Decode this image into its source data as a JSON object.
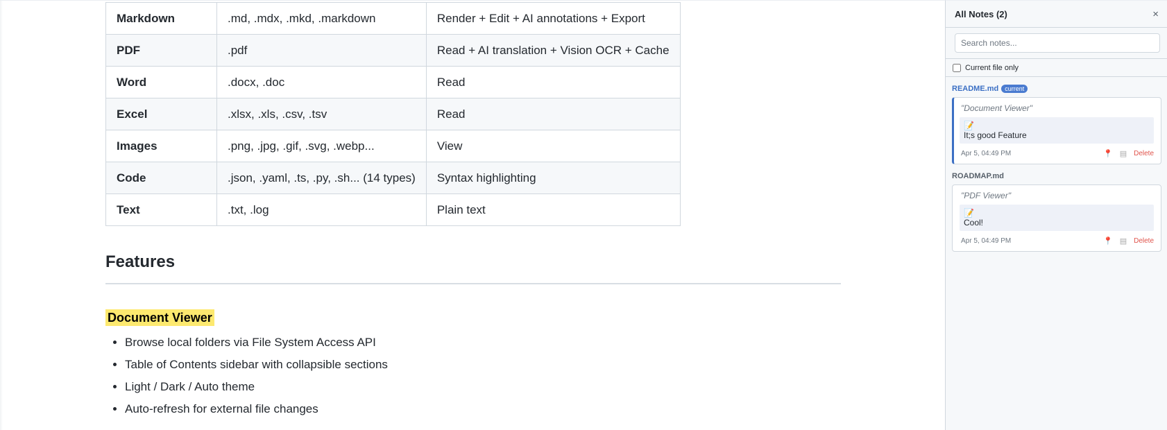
{
  "table": {
    "rows": [
      {
        "type": "Markdown",
        "ext": ".md, .mdx, .mkd, .markdown",
        "feature": "Render + Edit + AI annotations + Export"
      },
      {
        "type": "PDF",
        "ext": ".pdf",
        "feature": "Read + AI translation + Vision OCR + Cache"
      },
      {
        "type": "Word",
        "ext": ".docx, .doc",
        "feature": "Read"
      },
      {
        "type": "Excel",
        "ext": ".xlsx, .xls, .csv, .tsv",
        "feature": "Read"
      },
      {
        "type": "Images",
        "ext": ".png, .jpg, .gif, .svg, .webp...",
        "feature": "View"
      },
      {
        "type": "Code",
        "ext": ".json, .yaml, .ts, .py, .sh... (14 types)",
        "feature": "Syntax highlighting"
      },
      {
        "type": "Text",
        "ext": ".txt, .log",
        "feature": "Plain text"
      }
    ]
  },
  "features": {
    "heading": "Features",
    "subheading": "Document Viewer",
    "items": [
      "Browse local folders via File System Access API",
      "Table of Contents sidebar with collapsible sections",
      "Light / Dark / Auto theme",
      "Auto-refresh for external file changes"
    ]
  },
  "panel": {
    "title": "All Notes (2)",
    "close_icon": "×",
    "search_placeholder": "Search notes...",
    "filter_label": "Current file only",
    "groups": [
      {
        "file": "README.md",
        "badge": "current",
        "notes": [
          {
            "quote": "\"Document Viewer\"",
            "memo_icon": "📝",
            "text": "It;s good Feature",
            "date": "Apr 5, 04:49 PM",
            "delete_label": "Delete"
          }
        ]
      },
      {
        "file": "ROADMAP.md",
        "notes": [
          {
            "quote": "\"PDF Viewer\"",
            "memo_icon": "📝",
            "text": "Cool!",
            "date": "Apr 5, 04:49 PM",
            "delete_label": "Delete"
          }
        ]
      }
    ]
  },
  "colors": {
    "accent": "#3b6fc4",
    "highlight": "#fde96f",
    "delete": "#e0524a"
  }
}
